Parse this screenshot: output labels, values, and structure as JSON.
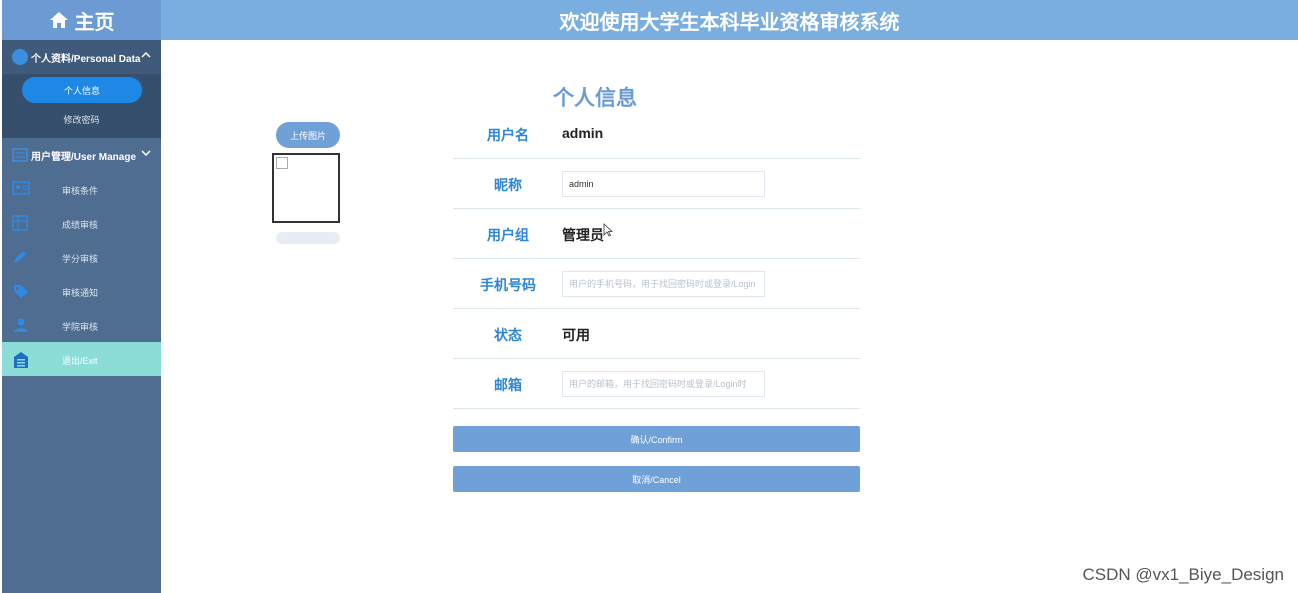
{
  "sidebar": {
    "home_label": "主页",
    "personal_section": "个人资料/Personal Data",
    "personal_items": [
      "个人信息",
      "修改密码"
    ],
    "user_section": "用户管理/User Manage",
    "menu": [
      {
        "label": "审核条件",
        "icon": "id-card-icon"
      },
      {
        "label": "成绩审核",
        "icon": "grid-icon"
      },
      {
        "label": "学分审核",
        "icon": "pencil-icon"
      },
      {
        "label": "审核通知",
        "icon": "tag-icon"
      },
      {
        "label": "学院审核",
        "icon": "people-icon"
      }
    ],
    "exit_label": "退出/Exit"
  },
  "header": {
    "title": "欢迎使用大学生本科毕业资格审核系统"
  },
  "main": {
    "title": "个人信息",
    "upload_label": "上传图片",
    "fields": {
      "username_label": "用户名",
      "username_value": "admin",
      "nickname_label": "昵称",
      "nickname_value": "admin",
      "group_label": "用户组",
      "group_value": "管理员",
      "phone_label": "手机号码",
      "phone_placeholder": "用户的手机号码，用于找回密码时或登录/Login",
      "status_label": "状态",
      "status_value": "可用",
      "email_label": "邮箱",
      "email_placeholder": "用户的邮箱，用于找回密码时或登录/Login时"
    },
    "confirm_label": "确认/Confirm",
    "cancel_label": "取消/Cancel"
  },
  "watermark": "CSDN @vx1_Biye_Design",
  "colors": {
    "sidebar": "#4f6d90",
    "header": "#7aaee0",
    "accent": "#6fa0d8",
    "selected": "#1e88e5",
    "exit": "#8cdcd8"
  }
}
